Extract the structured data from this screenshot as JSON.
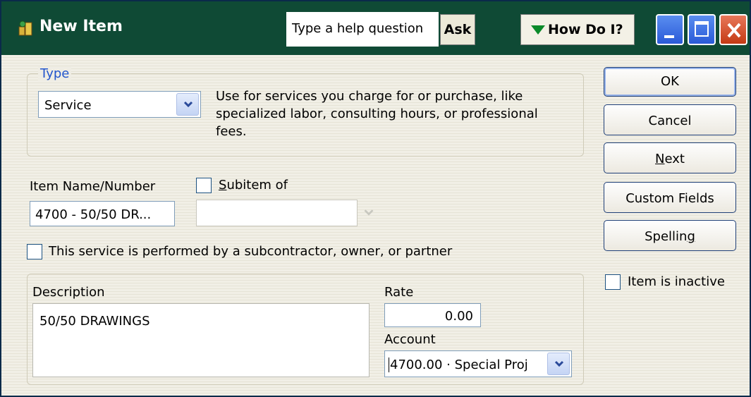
{
  "window": {
    "title": "New Item",
    "help_placeholder": "Type a help question",
    "ask_label": "Ask",
    "how_do_i_label": "How Do I?"
  },
  "type_section": {
    "legend": "Type",
    "selected": "Service",
    "description": "Use for services you charge for or purchase, like specialized labor, consulting hours, or professional fees."
  },
  "item": {
    "name_label": "Item Name/Number",
    "name_value": "4700 - 50/50 DR...",
    "subitem_label_prefix": "S",
    "subitem_label_rest": "ubitem of",
    "subitem_checked": false,
    "subitem_value": ""
  },
  "subcontractor": {
    "label": "This service is performed by a subcontractor, owner, or partner",
    "checked": false
  },
  "details": {
    "description_label": "Description",
    "description_value": "50/50 DRAWINGS",
    "rate_label": "Rate",
    "rate_value": "0.00",
    "account_label": "Account",
    "account_value": "4700.00 · Special Proj"
  },
  "buttons": {
    "ok": "OK",
    "cancel": "Cancel",
    "next_prefix": "N",
    "next_rest": "ext",
    "custom_fields": "Custom Fields",
    "spelling_prefix": "Spellin",
    "spelling_ul": "g",
    "inactive_label": "Item is inactive",
    "inactive_checked": false
  },
  "colors": {
    "titlebar": "#0f4a35",
    "type_legend": "#2255cc",
    "how_do_i_triangle": "#0a8a2a"
  }
}
